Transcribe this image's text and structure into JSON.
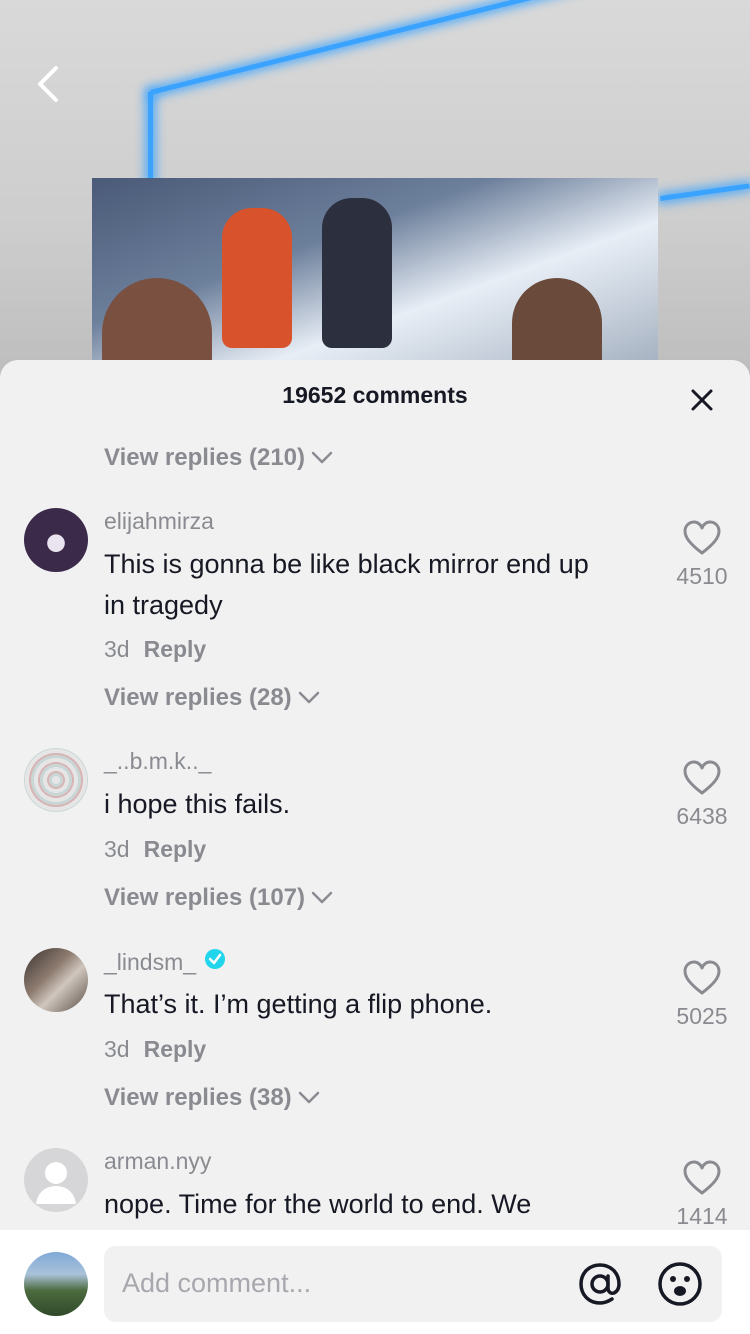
{
  "header": {
    "comment_count": "19652 comments"
  },
  "threads": [
    {
      "view_replies": "View replies (210)"
    }
  ],
  "comments": [
    {
      "username": "elijahmirza",
      "text_line1": "This is gonna be like black mirror end up",
      "text_line2": "in tragedy",
      "age": "3d",
      "reply_label": "Reply",
      "likes": "4510",
      "view_replies": "View replies (28)",
      "verified": false
    },
    {
      "username": "_..b.m.k.._",
      "text_line1": "i hope this fails.",
      "age": "3d",
      "reply_label": "Reply",
      "likes": "6438",
      "view_replies": "View replies (107)",
      "verified": false
    },
    {
      "username": "_lindsm_",
      "text_line1": "That’s it. I’m getting a flip phone.",
      "age": "3d",
      "reply_label": "Reply",
      "likes": "5025",
      "view_replies": "View replies (38)",
      "verified": true
    },
    {
      "username": "arman.nyy",
      "text_line1": "nope. Time for the world to end. We",
      "likes": "1414",
      "verified": false
    }
  ],
  "composer": {
    "placeholder": "Add comment..."
  },
  "colors": {
    "sheet_bg": "#f1f1f1",
    "primary_text": "#161823",
    "secondary_text": "#8a8b91",
    "verified": "#20d5ec",
    "led": "#3aa3ff"
  },
  "icons": [
    "back-arrow-icon",
    "close-icon",
    "chevron-down-icon",
    "heart-icon",
    "verified-badge-icon",
    "mention-icon",
    "emoji-icon"
  ]
}
